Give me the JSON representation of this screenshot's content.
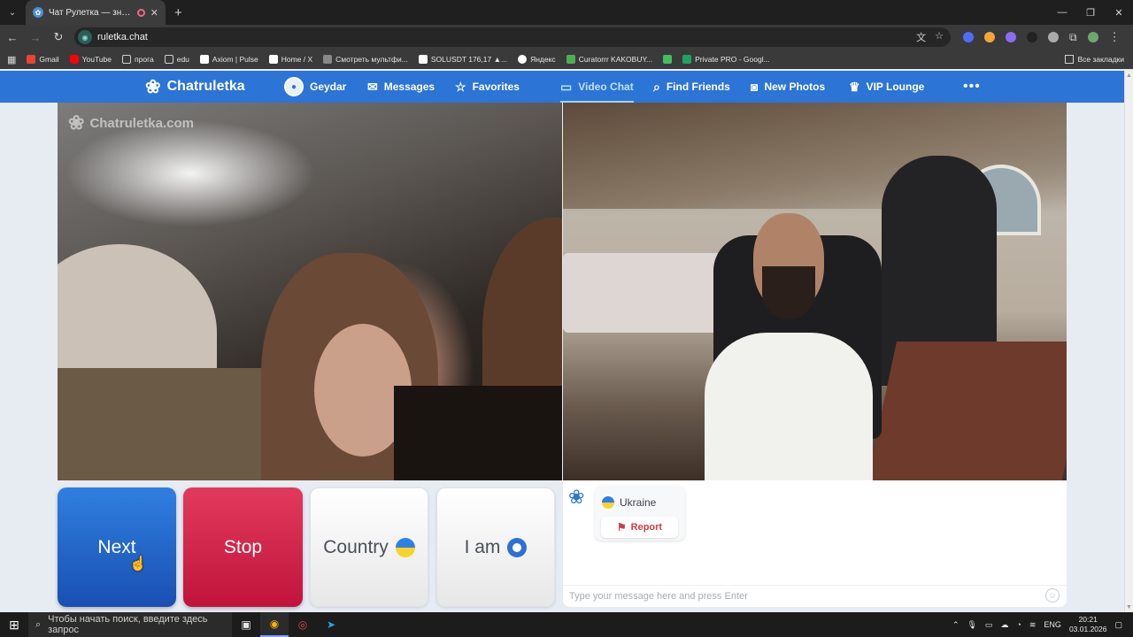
{
  "browser": {
    "tab_title": "Чат Рулетка — знакомств...",
    "url": "ruletka.chat",
    "bookmarks": [
      {
        "label": "Gmail",
        "color": "#ea4335"
      },
      {
        "label": "YouTube",
        "color": "#ff0000"
      },
      {
        "label": "прога",
        "color": "#d0d0d0"
      },
      {
        "label": "edu",
        "color": "#d0d0d0"
      },
      {
        "label": "Axiom | Pulse",
        "color": "#ffffff"
      },
      {
        "label": "Home / X",
        "color": "#ffffff"
      },
      {
        "label": "Смотреть мультфи...",
        "color": "#888888"
      },
      {
        "label": "SOLUSDT 176,17 ▲...",
        "color": "#ffffff"
      },
      {
        "label": "Яндекс",
        "color": "#ffffff"
      },
      {
        "label": "Curatorrr KAKOBUY...",
        "color": "#4caf50"
      },
      {
        "label": "",
        "color": "#3fbf5f"
      },
      {
        "label": "Private PRO - Googl...",
        "color": "#1fa463"
      }
    ],
    "all_bookmarks": "Все закладки"
  },
  "site": {
    "logo": "Chatruletka",
    "nav": {
      "user": "Geydar",
      "messages": "Messages",
      "favorites": "Favorites",
      "video_chat": "Video Chat",
      "find_friends": "Find Friends",
      "new_photos": "New Photos",
      "vip": "VIP Lounge",
      "more": "•••"
    },
    "watermark": "Chatruletka.com"
  },
  "controls": {
    "next": "Next",
    "stop": "Stop",
    "country": "Country",
    "iam": "I am"
  },
  "chat": {
    "partner_country": "Ukraine",
    "report": "Report",
    "input_placeholder": "Type your message here and press Enter"
  },
  "taskbar": {
    "search_placeholder": "Чтобы начать поиск, введите здесь запрос",
    "lang": "ENG",
    "time": "20:21",
    "date": "03.01.2026"
  }
}
